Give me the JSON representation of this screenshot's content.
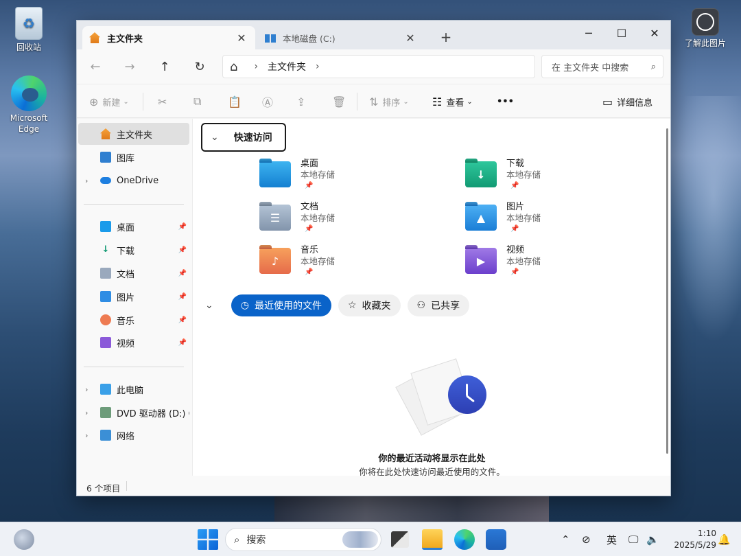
{
  "desktop": {
    "icons": [
      {
        "label": "回收站"
      },
      {
        "label": "Microsoft Edge"
      },
      {
        "label": "了解此图片"
      }
    ]
  },
  "window": {
    "tabs": [
      {
        "label": "主文件夹",
        "active": true
      },
      {
        "label": "本地磁盘 (C:)",
        "active": false
      }
    ],
    "new_tab": "+",
    "controls": {
      "minimize": "─",
      "maximize": "☐",
      "close": "✕"
    }
  },
  "nav": {
    "back": "←",
    "forward": "→",
    "up": "↑",
    "refresh": "↻",
    "breadcrumb": "主文件夹",
    "search_placeholder": "在 主文件夹 中搜索"
  },
  "toolbar": {
    "new_label": "新建",
    "sort_label": "排序",
    "view_label": "查看",
    "more_label": "•••",
    "details_label": "详细信息"
  },
  "sidebar": {
    "items": [
      {
        "label": "主文件夹",
        "selected": true
      },
      {
        "label": "图库"
      },
      {
        "label": "OneDrive"
      },
      {
        "label": "桌面",
        "pinned": true
      },
      {
        "label": "下载",
        "pinned": true
      },
      {
        "label": "文档",
        "pinned": true
      },
      {
        "label": "图片",
        "pinned": true
      },
      {
        "label": "音乐",
        "pinned": true
      },
      {
        "label": "视频",
        "pinned": true
      },
      {
        "label": "此电脑"
      },
      {
        "label": "DVD 驱动器 (D:) C"
      },
      {
        "label": "网络"
      }
    ]
  },
  "quick_access": {
    "title": "快速访问",
    "items": [
      {
        "name": "桌面",
        "location": "本地存储",
        "icon": "desktop-folder-icon"
      },
      {
        "name": "下载",
        "location": "本地存储",
        "icon": "downloads-folder-icon"
      },
      {
        "name": "文档",
        "location": "本地存储",
        "icon": "documents-folder-icon"
      },
      {
        "name": "图片",
        "location": "本地存储",
        "icon": "pictures-folder-icon"
      },
      {
        "name": "音乐",
        "location": "本地存储",
        "icon": "music-folder-icon"
      },
      {
        "name": "视频",
        "location": "本地存储",
        "icon": "videos-folder-icon"
      }
    ]
  },
  "recent": {
    "tabs": [
      {
        "label": "最近使用的文件",
        "active": true
      },
      {
        "label": "收藏夹"
      },
      {
        "label": "已共享"
      }
    ],
    "empty_title": "你的最近活动将显示在此处",
    "empty_sub": "你将在此处快速访问最近使用的文件。"
  },
  "status": {
    "items_count": "6 个项目"
  },
  "taskbar": {
    "search_label": "搜索",
    "ime": "英",
    "time": "1:10",
    "date": "2025/5/29"
  },
  "colors": {
    "accent": "#0a63c9",
    "window_bg": "#f3f3f3"
  }
}
